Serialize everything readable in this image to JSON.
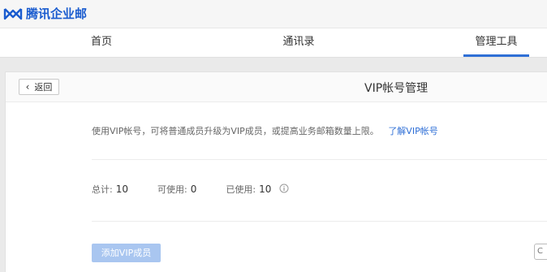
{
  "app": {
    "logo_text": "腾讯企业邮"
  },
  "nav": {
    "tabs": [
      {
        "label": "首页"
      },
      {
        "label": "通讯录"
      },
      {
        "label": "管理工具",
        "active": true
      }
    ]
  },
  "header": {
    "back_label": "返回",
    "title": "VIP帐号管理"
  },
  "main": {
    "description": "使用VIP帐号，可将普通成员升级为VIP成员，或提高业务邮箱数量上限。",
    "learn_link": "了解VIP帐号",
    "stats": {
      "total_label": "总计:",
      "total_value": "10",
      "available_label": "可使用:",
      "available_value": "0",
      "used_label": "已使用:",
      "used_value": "10"
    },
    "add_button": "添加VIP成员",
    "edge_glyph": "C"
  },
  "colors": {
    "brand": "#1a5ccf",
    "accent": "#2f6fd6",
    "button_disabled": "#a9c6f0"
  }
}
